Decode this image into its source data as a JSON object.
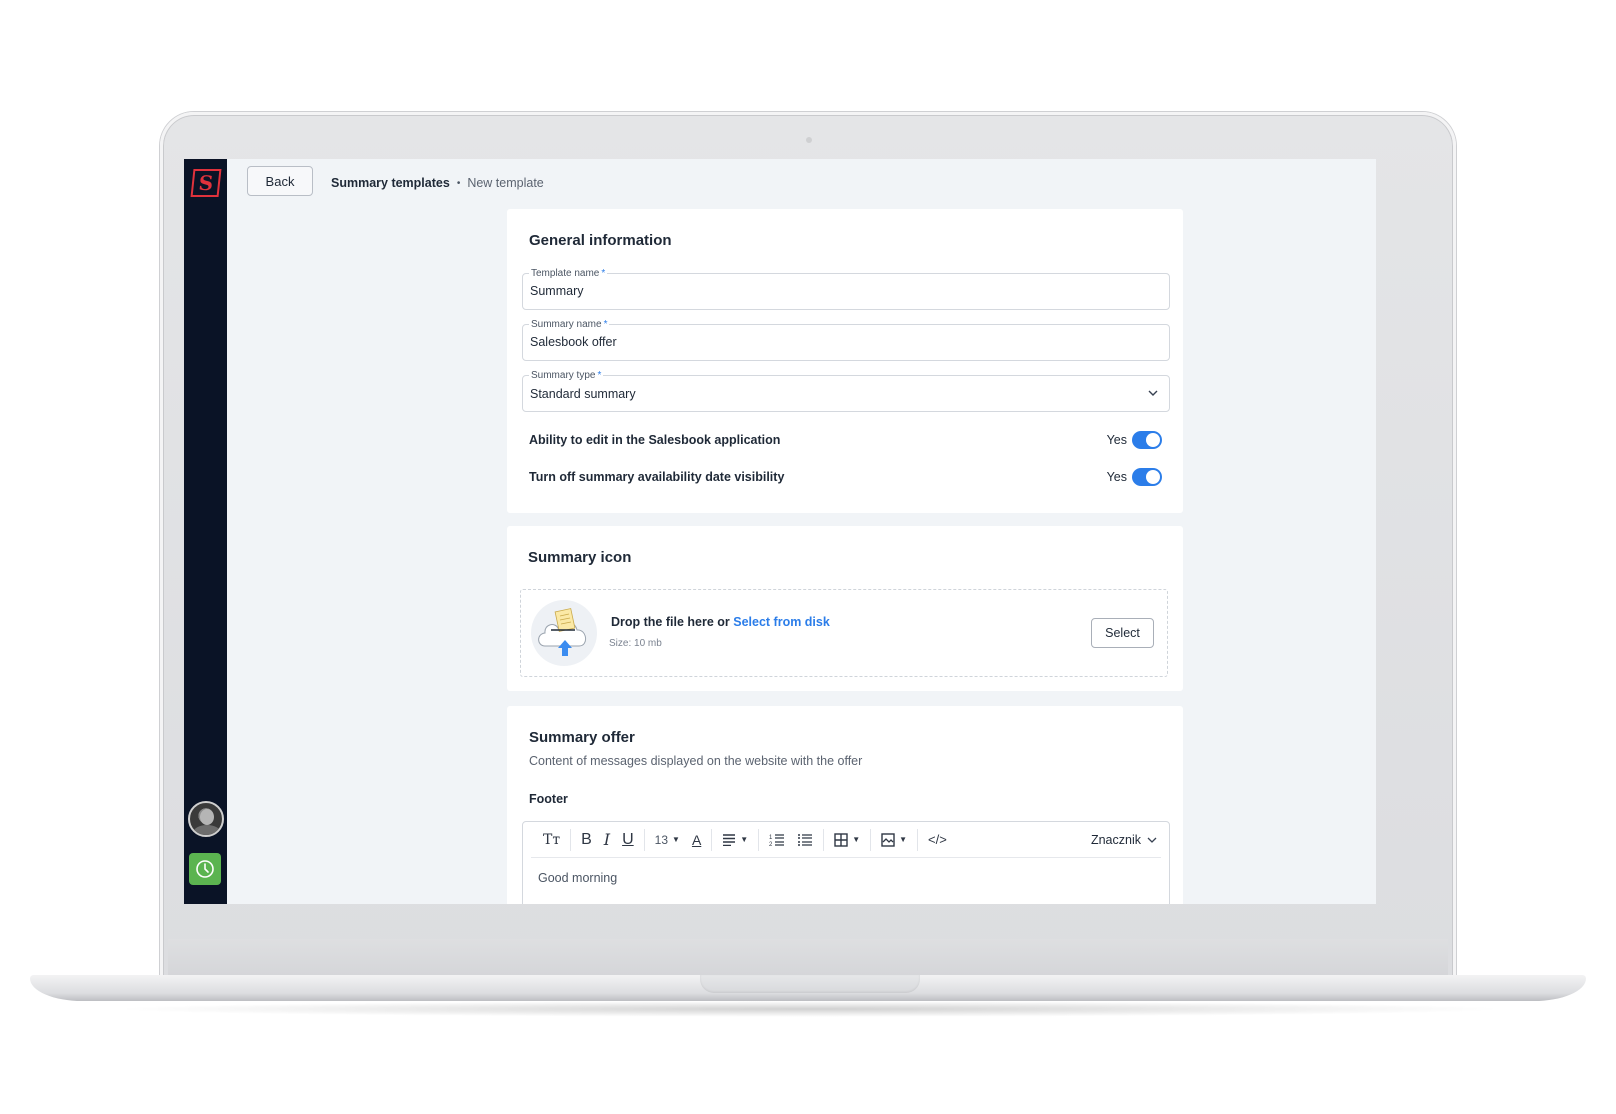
{
  "app": {
    "logo_letter": "S",
    "back_label": "Back",
    "breadcrumb": {
      "root": "Summary templates",
      "separator": "•",
      "current": "New template"
    }
  },
  "general_info": {
    "title": "General information",
    "fields": [
      {
        "label": "Template name",
        "required_mark": "*",
        "value": "Summary"
      },
      {
        "label": "Summary name",
        "required_mark": "*",
        "value": "Salesbook offer"
      },
      {
        "label": "Summary type",
        "required_mark": "*",
        "value": "Standard summary"
      }
    ],
    "toggles": [
      {
        "label": "Ability to edit in the Salesbook application",
        "value_text": "Yes",
        "on": true
      },
      {
        "label": "Turn off summary availability date visibility",
        "value_text": "Yes",
        "on": true
      }
    ]
  },
  "summary_icon": {
    "title": "Summary icon",
    "drop_text": "Drop the file here or ",
    "drop_link": "Select from disk",
    "size_text": "Size: 10 mb",
    "select_label": "Select"
  },
  "summary_offer": {
    "title": "Summary offer",
    "subtitle": "Content of messages displayed on the website with the offer",
    "footer_label": "Footer",
    "toolbar": {
      "text_style": "Tт",
      "bold": "B",
      "italic": "I",
      "underline": "U",
      "font_size": "13",
      "font_color": "A",
      "code": "</>",
      "marker_label": "Znacznik"
    },
    "editor_content": "Good morning"
  },
  "colors": {
    "accent": "#2b7de9",
    "sidebar": "#0a1326",
    "logo_red": "#e0323c",
    "clock_green": "#5bb450"
  }
}
